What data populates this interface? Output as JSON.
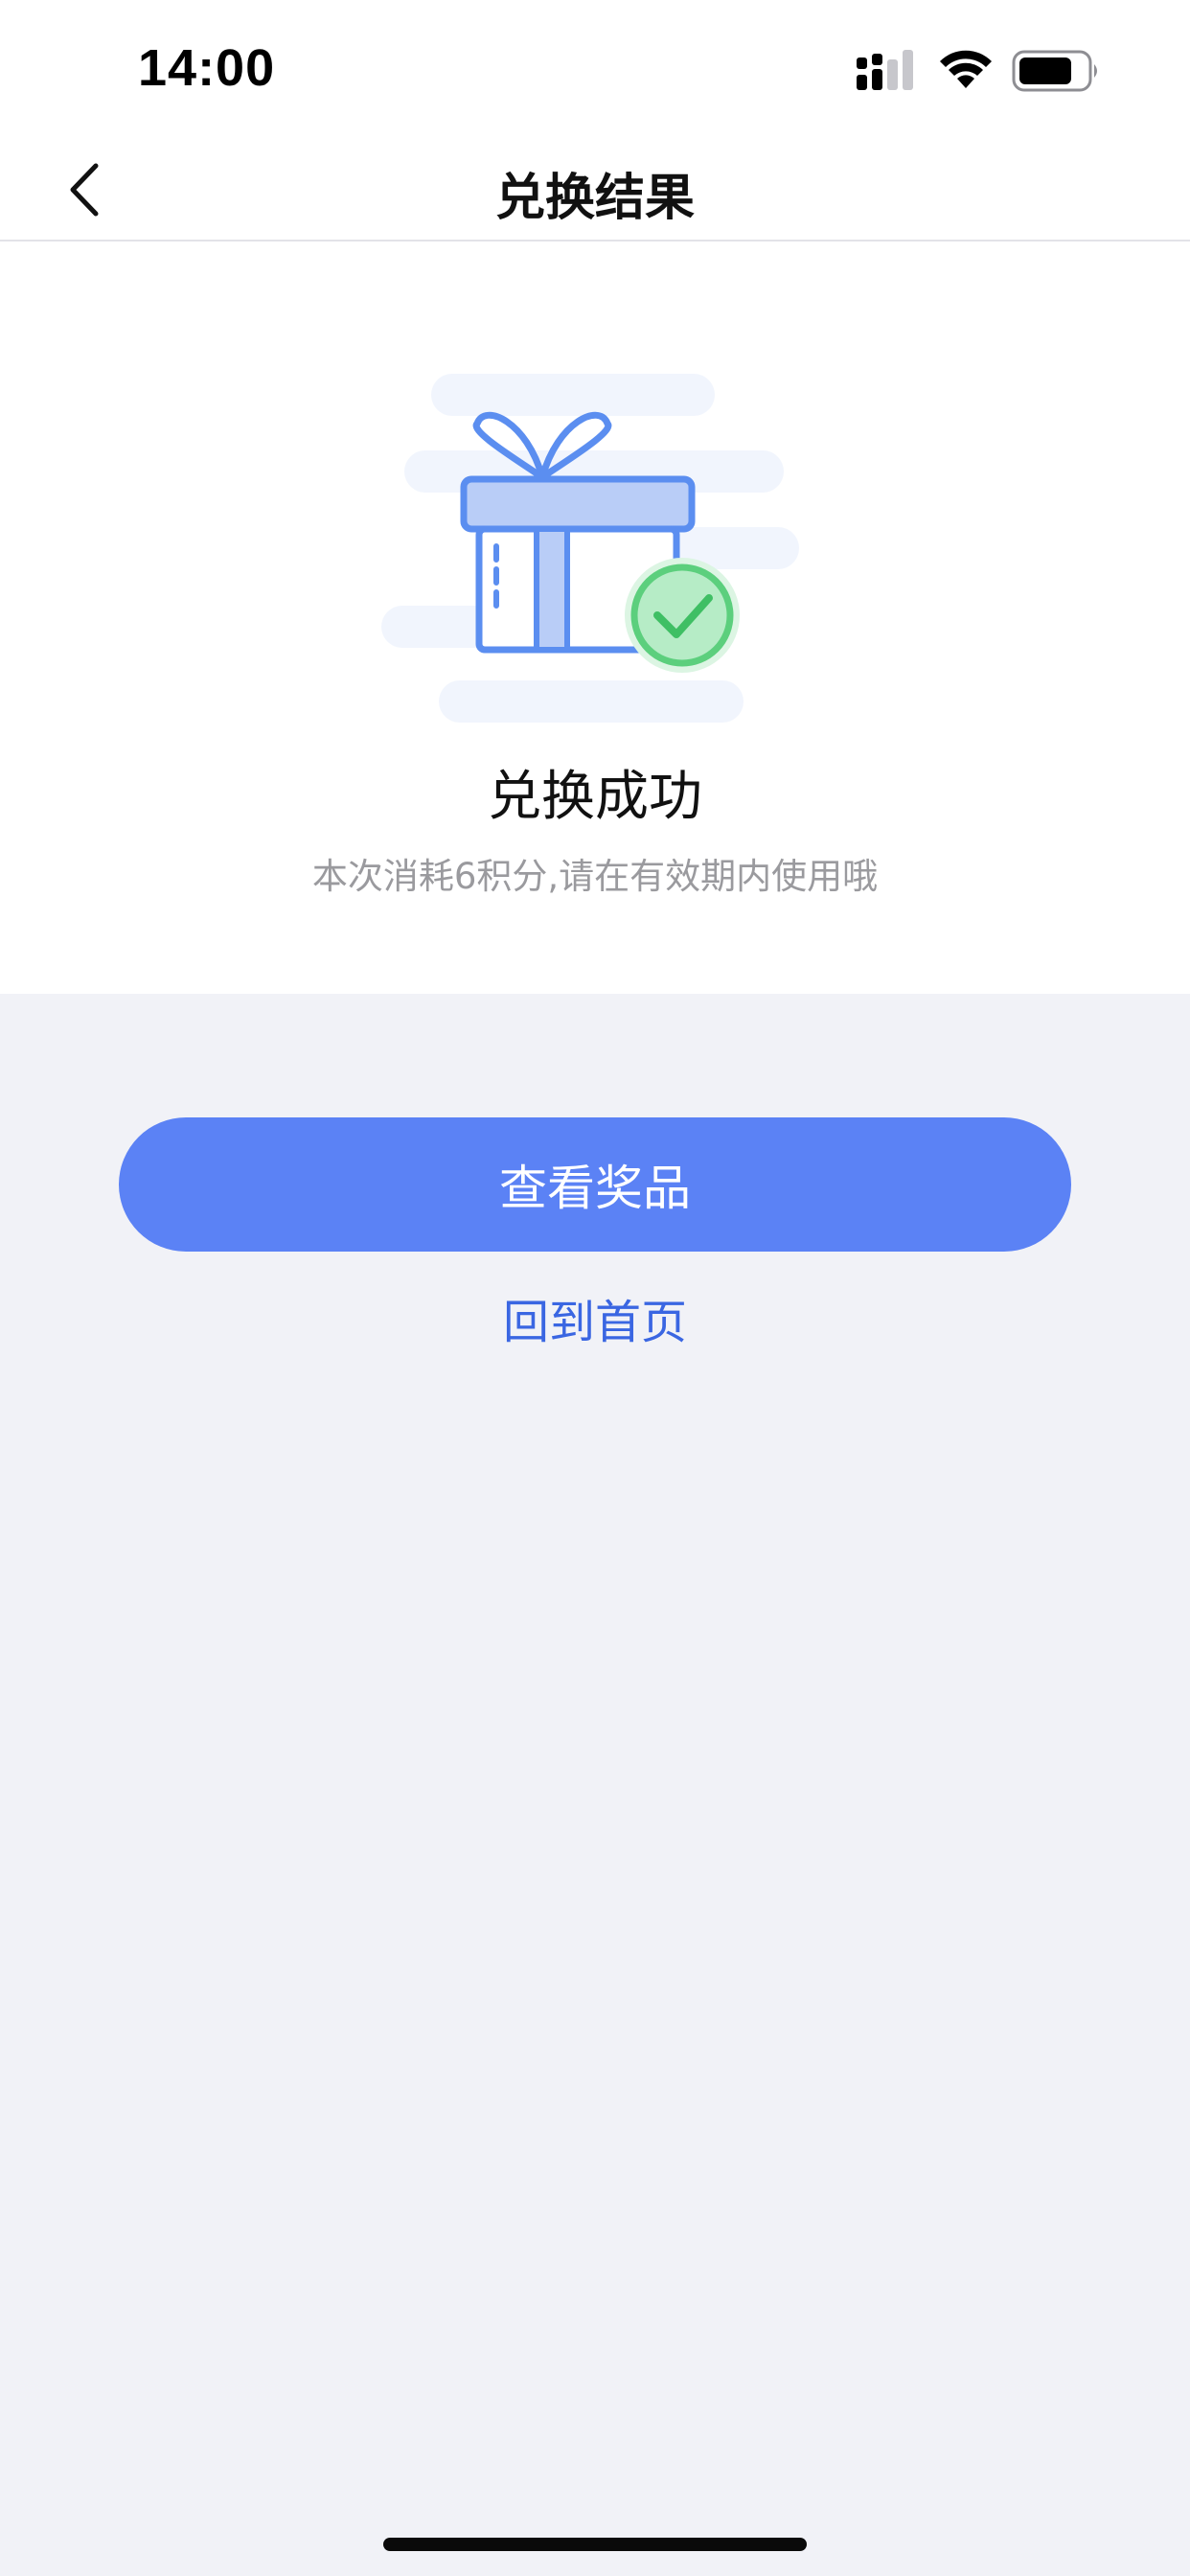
{
  "status_bar": {
    "time": "14:00"
  },
  "nav": {
    "title": "兑换结果",
    "back_icon": "chevron-left-icon"
  },
  "result": {
    "illustration_icon": "gift-success-icon",
    "title": "兑换成功",
    "subtitle": "本次消耗6积分,请在有效期内使用哦"
  },
  "actions": {
    "view_prize_label": "查看奖品",
    "back_home_label": "回到首页"
  },
  "colors": {
    "primary": "#5b82f5",
    "link": "#3a66e2",
    "success": "#5ccf7d",
    "gift": "#5b8ef0",
    "background": "#f1f2f7"
  }
}
